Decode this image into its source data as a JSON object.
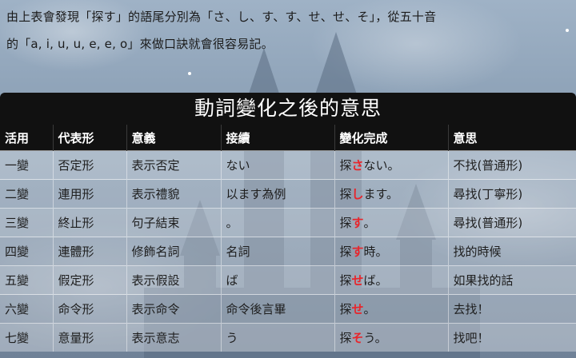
{
  "intro": {
    "line1": "由上表會發現「探す」的語尾分別為「さ、し、す、す、せ、せ、そ」，從五十音",
    "line2": "的「a, i, u, u, e, e, o」來做口訣就會很容易記。"
  },
  "table": {
    "title": "動詞變化之後的意思",
    "headers": [
      "活用",
      "代表形",
      "意義",
      "接續",
      "變化完成",
      "意思"
    ],
    "rows": [
      {
        "c1": "一變",
        "c2": "否定形",
        "c3": "表示否定",
        "c4": "ない",
        "pre": "探",
        "kana": "さ",
        "post": "ない。",
        "c6": "不找(普通形)"
      },
      {
        "c1": "二變",
        "c2": "連用形",
        "c3": "表示禮貌",
        "c4": "以ます為例",
        "pre": "探",
        "kana": "し",
        "post": "ます。",
        "c6": "尋找(丁寧形)"
      },
      {
        "c1": "三變",
        "c2": "終止形",
        "c3": "句子結束",
        "c4": "。",
        "pre": "探",
        "kana": "す",
        "post": "。",
        "c6": "尋找(普通形)"
      },
      {
        "c1": "四變",
        "c2": "連體形",
        "c3": "修飾名詞",
        "c4": "名詞",
        "pre": "探",
        "kana": "す",
        "post": "時。",
        "c6": "找的時候"
      },
      {
        "c1": "五變",
        "c2": "假定形",
        "c3": "表示假設",
        "c4": "ば",
        "pre": "探",
        "kana": "せ",
        "post": "ば。",
        "c6": "如果找的話"
      },
      {
        "c1": "六變",
        "c2": "命令形",
        "c3": "表示命令",
        "c4": "命令後言畢",
        "pre": "探",
        "kana": "せ",
        "post": "。",
        "c6": "去找！"
      },
      {
        "c1": "七變",
        "c2": "意量形",
        "c3": "表示意志",
        "c4": "う",
        "pre": "探",
        "kana": "そ",
        "post": "う。",
        "c6": "找吧！"
      }
    ]
  },
  "colors": {
    "header_bg": "#111111",
    "highlight": "#e8252b"
  }
}
